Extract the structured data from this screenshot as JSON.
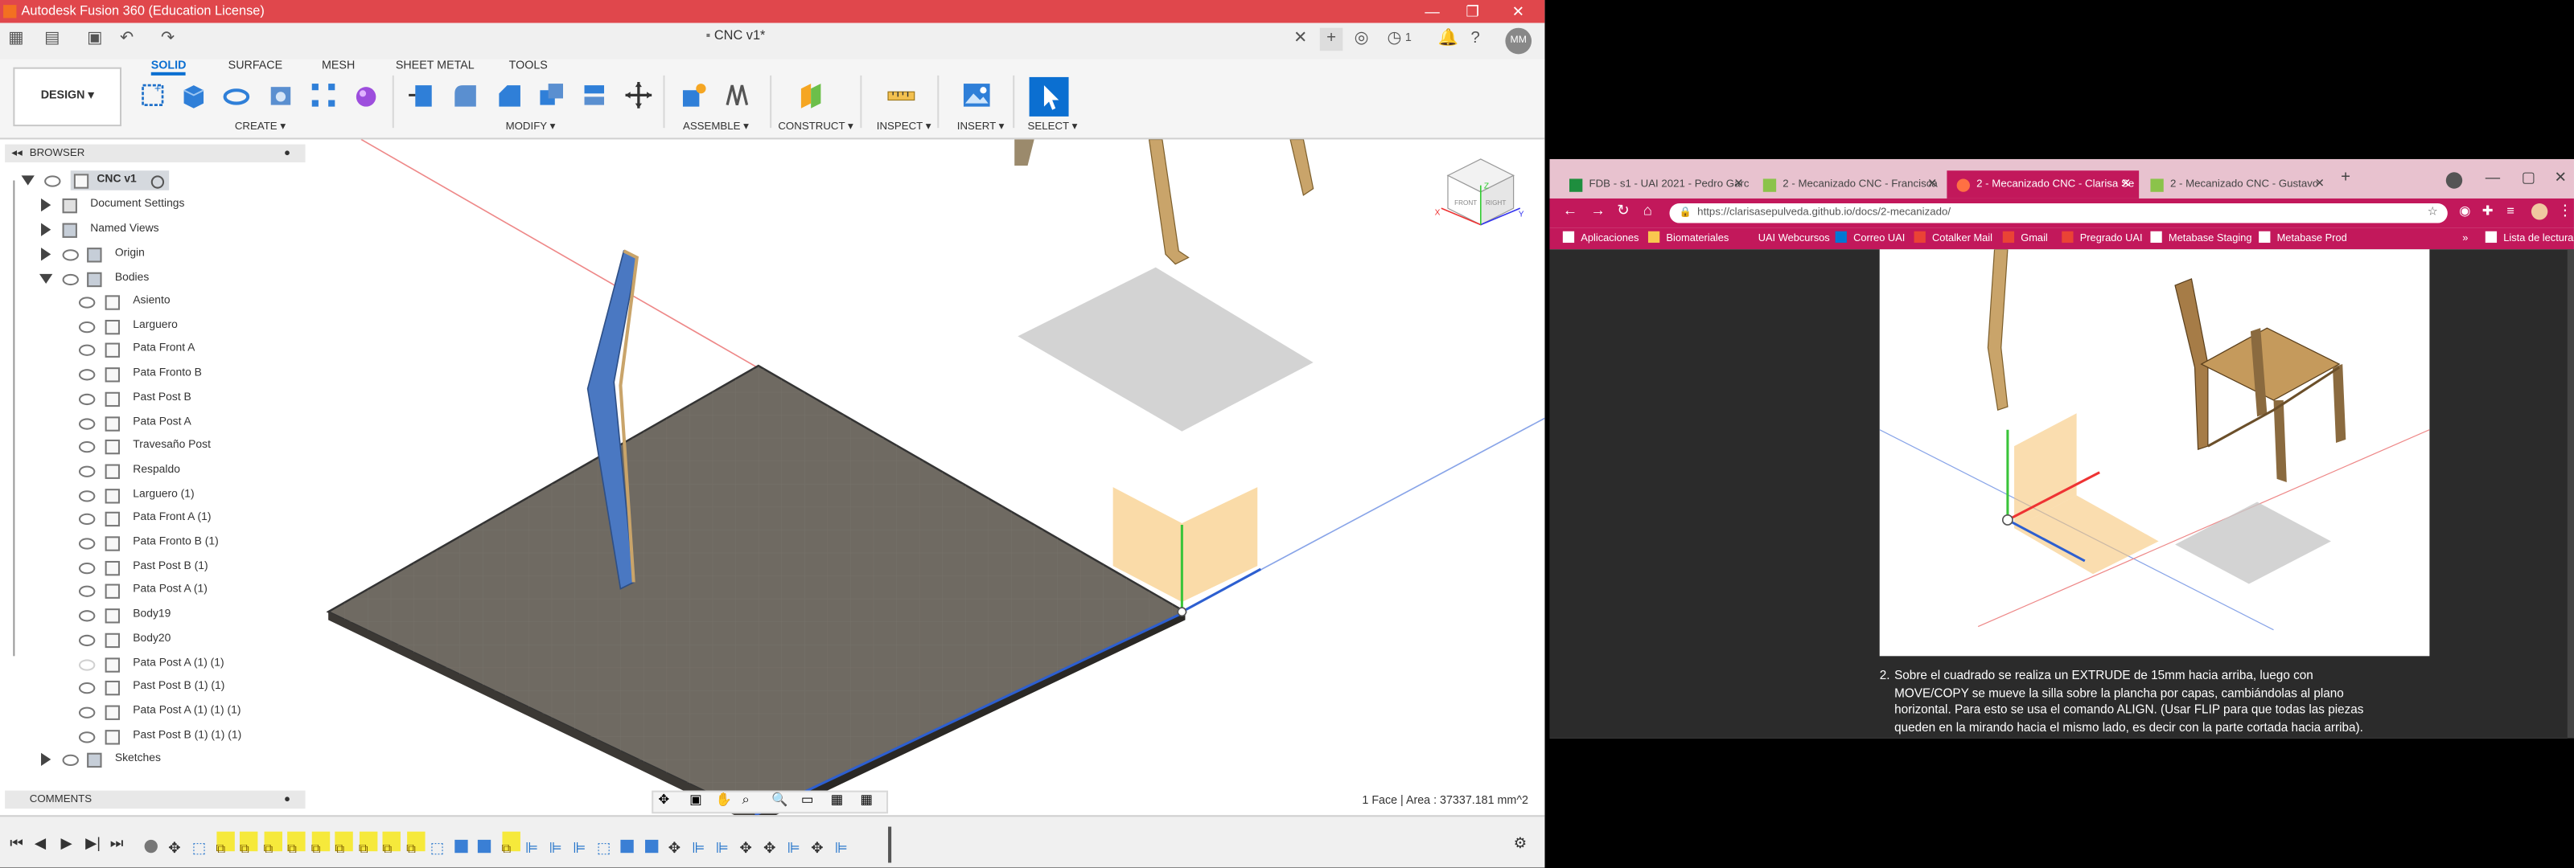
{
  "fusion": {
    "title": "Autodesk Fusion 360 (Education License)",
    "doc_tab": "CNC v1*",
    "user_initials": "MM",
    "notifications_count": "1",
    "design_button": "DESIGN",
    "panel_tabs": [
      "SOLID",
      "SURFACE",
      "MESH",
      "SHEET METAL",
      "TOOLS"
    ],
    "active_tab": "SOLID",
    "groups": [
      "CREATE",
      "MODIFY",
      "ASSEMBLE",
      "CONSTRUCT",
      "INSPECT",
      "INSERT",
      "SELECT"
    ],
    "browser": {
      "title": "BROWSER",
      "root": "CNC v1",
      "folders": [
        "Document Settings",
        "Named Views",
        "Origin",
        "Bodies"
      ],
      "bodies": [
        "Asiento",
        "Larguero",
        "Pata Front A",
        "Pata Fronto B",
        "Past Post B",
        "Pata Post A",
        "Travesaño Post",
        "Respaldo",
        "Larguero (1)",
        "Pata Front A (1)",
        "Pata Fronto B (1)",
        "Past Post B (1)",
        "Pata Post A (1)",
        "Body19",
        "Body20",
        "Pata Post A (1) (1)",
        "Past Post B (1) (1)",
        "Pata Post A (1) (1) (1)",
        "Past Post B (1) (1) (1)"
      ],
      "sketches": "Sketches"
    },
    "comments_title": "COMMENTS",
    "status": "1 Face | Area : 37337.181 mm^2",
    "viewcube": {
      "front": "FRONT",
      "right": "RIGHT",
      "x": "X",
      "y": "Y",
      "z": "Z"
    }
  },
  "chrome": {
    "tabs": [
      "FDB - s1 - UAI 2021 - Pedro Garc",
      "2 - Mecanizado CNC - Francisca",
      "2 - Mecanizado CNC - Clarisa Se",
      "2 - Mecanizado CNC - Gustavo"
    ],
    "active_tab": 2,
    "url": "https://clarisasepulveda.github.io/docs/2-mecanizado/",
    "bookmarks": [
      "Aplicaciones",
      "Biomateriales",
      "UAI Webcursos",
      "Correo UAI",
      "Cotalker Mail",
      "Gmail",
      "Pregrado UAI",
      "Metabase Staging",
      "Metabase Prod",
      "Lista de lectura"
    ],
    "doc": {
      "step_number": "2.",
      "step_text": "Sobre el cuadrado se realiza un EXTRUDE de 15mm hacia arriba, luego con MOVE/COPY se mueve la silla sobre la plancha por capas, cambiándolas al plano horizontal. Para esto se usa el comando ALIGN. (Usar FLIP para que todas las piezas queden en la mirando hacia el mismo lado, es decir con la parte cortada hacia arriba)."
    }
  },
  "colors": {
    "fusion_title": "#e0474c",
    "chrome_accent": "#c2185b",
    "selection_blue": "#0b6fd1",
    "body_blue": "#4a78c2",
    "wood": "#c9a46a",
    "plate": "#6f6a62",
    "timeline_highlight": "#f6e93b"
  }
}
